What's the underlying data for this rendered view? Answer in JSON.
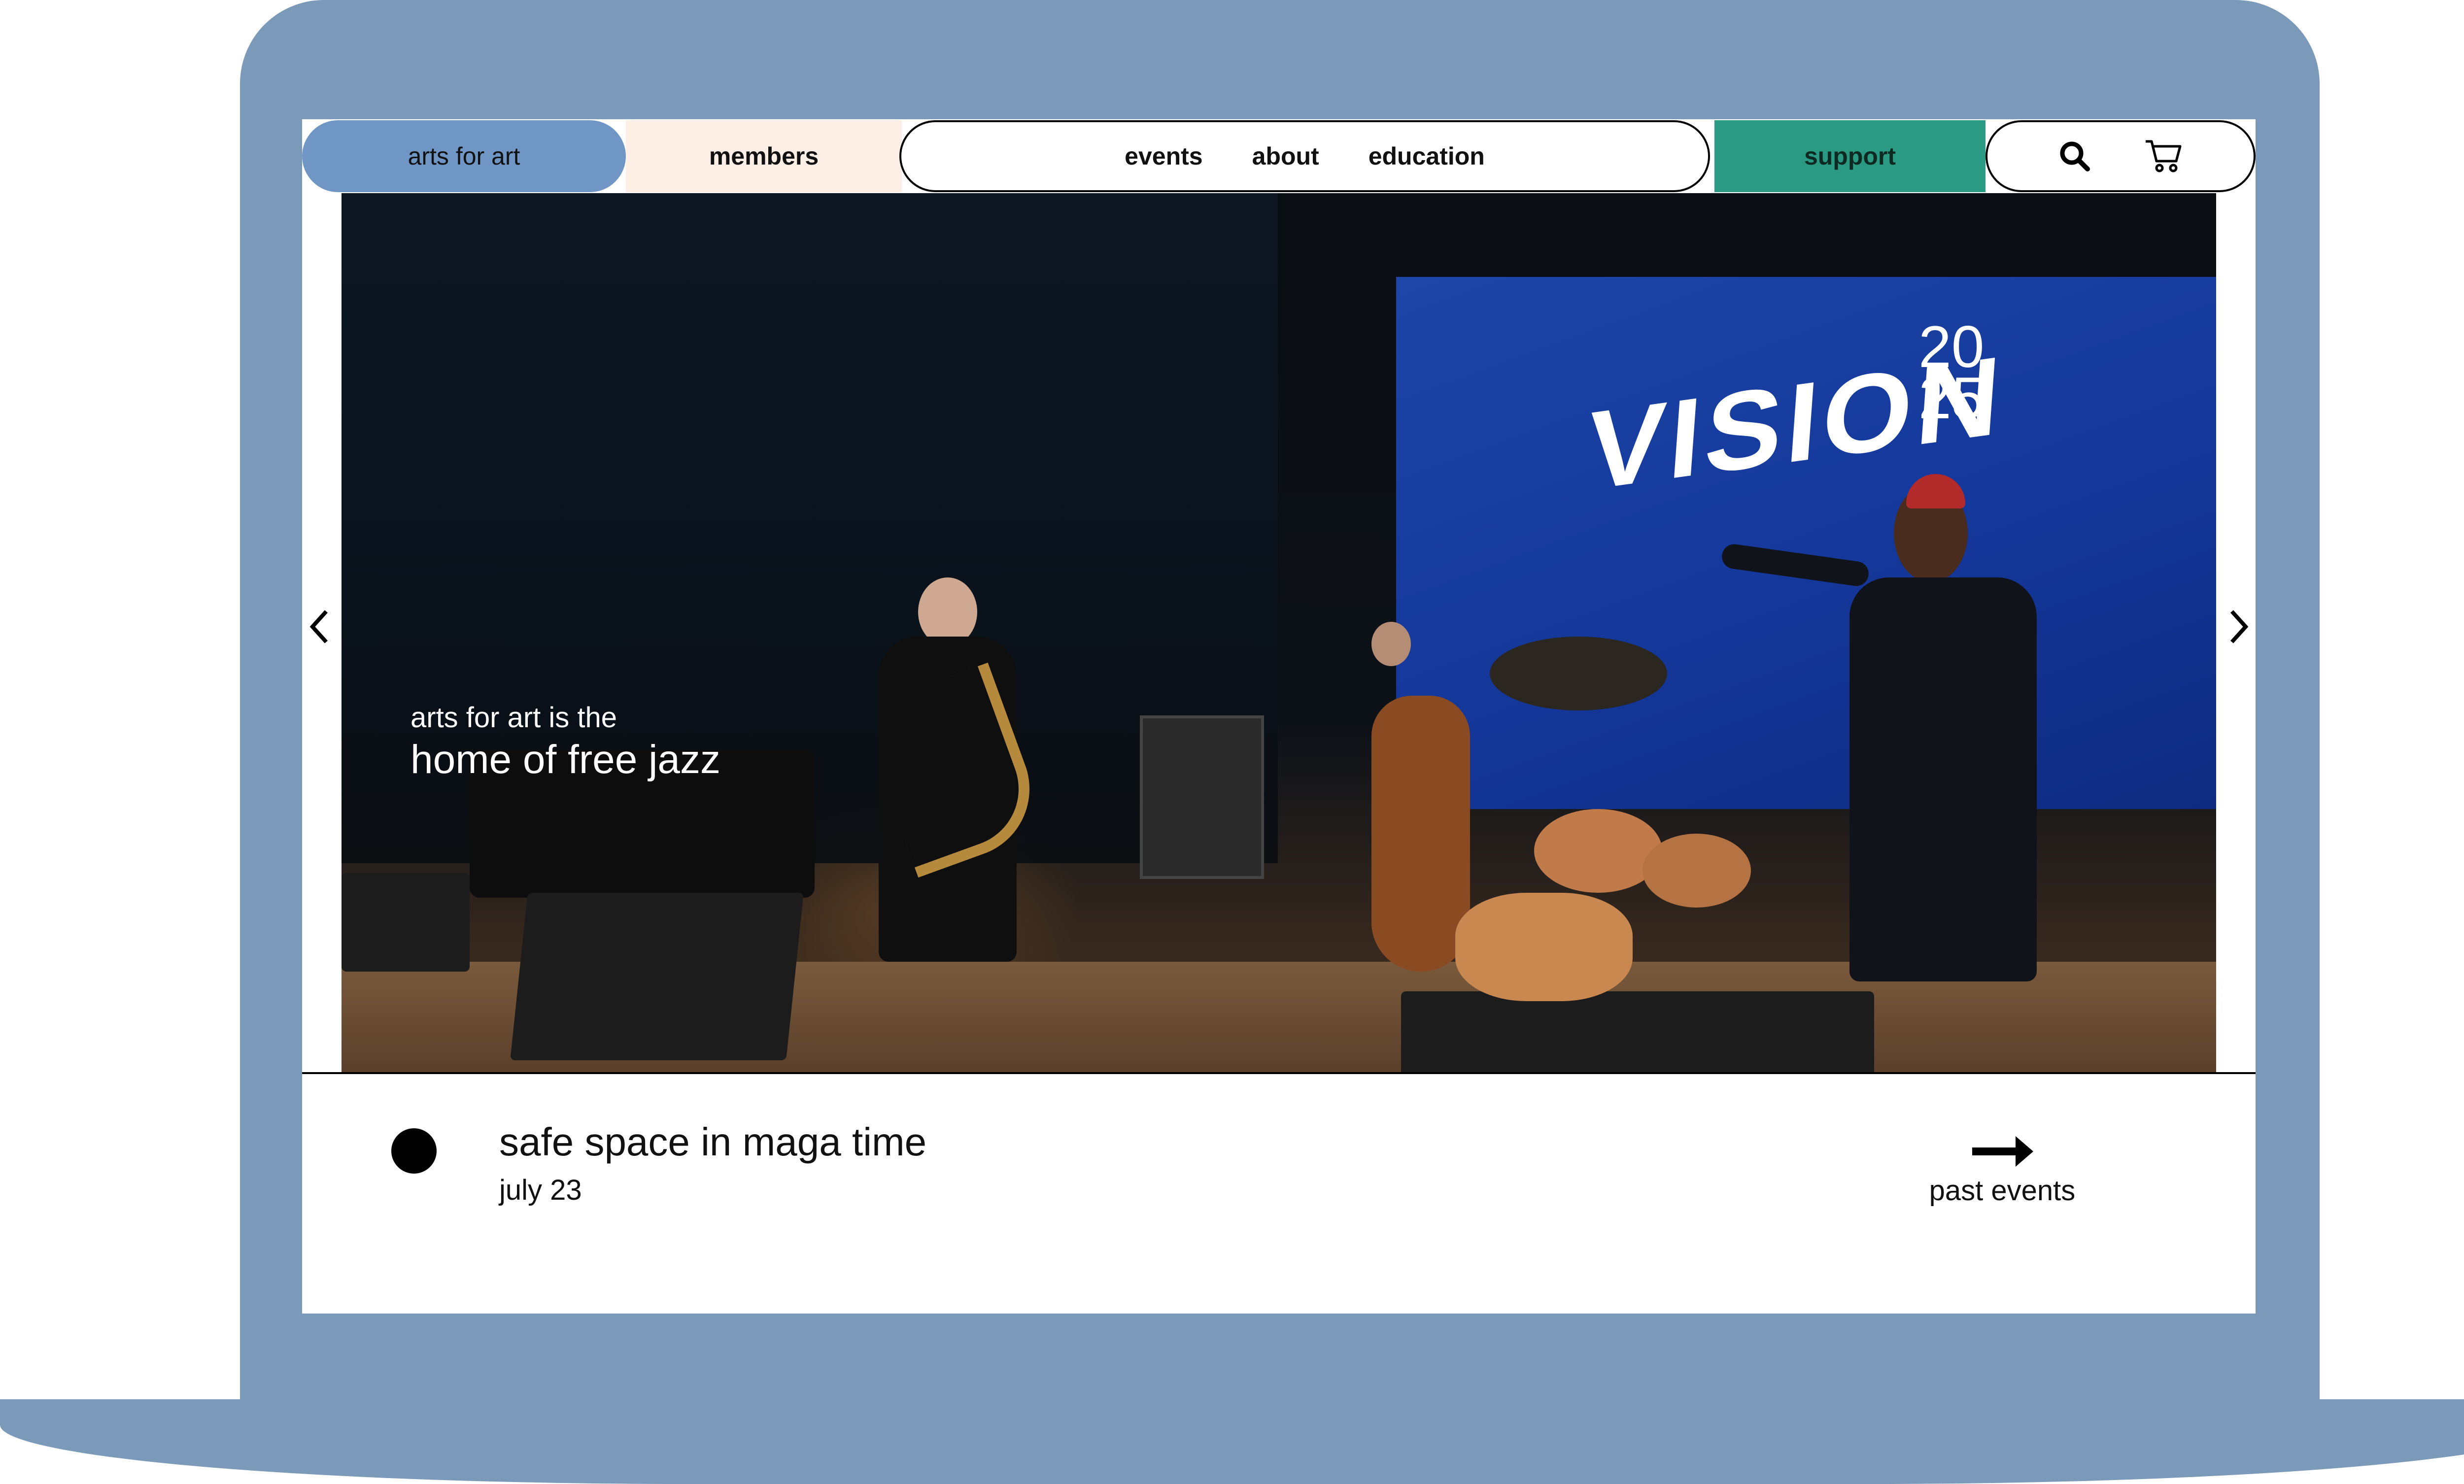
{
  "nav": {
    "logo_label": "arts for art",
    "members_label": "members",
    "links": [
      "events",
      "about",
      "education"
    ],
    "support_label": "support",
    "search_icon": "search-icon",
    "cart_icon": "cart-icon"
  },
  "hero": {
    "caption_small": "arts for art is the",
    "caption_large": "home of free jazz",
    "screen_word": "VISION",
    "screen_year_top": "20",
    "screen_year_bottom": "25",
    "prev_icon": "chevron-left-icon",
    "next_icon": "chevron-right-icon"
  },
  "event": {
    "title": "safe space in maga time",
    "date": "july 23",
    "past_label": "past events",
    "past_icon": "arrow-right-icon"
  },
  "colors": {
    "frame": "#7b99b9",
    "logo_bg": "#6f96c4",
    "members_bg": "#fdeee6",
    "support_bg": "#2a9a82",
    "screen_blue": "#1d46a8"
  }
}
